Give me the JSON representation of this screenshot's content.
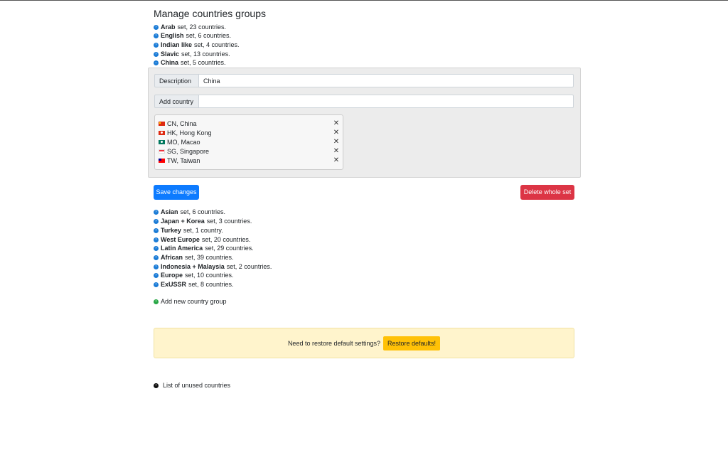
{
  "page_title": "Manage countries groups",
  "groups_top": [
    {
      "name": "Arab",
      "desc": "set, 23 countries."
    },
    {
      "name": "English",
      "desc": "set, 6 countries."
    },
    {
      "name": "Indian like",
      "desc": "set, 4 countries."
    },
    {
      "name": "Slavic",
      "desc": "set, 13 countries."
    },
    {
      "name": "China",
      "desc": "set, 5 countries."
    }
  ],
  "editor": {
    "description_label": "Description",
    "description_value": "China",
    "add_country_label": "Add country",
    "add_country_value": "",
    "countries": [
      {
        "label": "CN, China",
        "flag": "flag-cn"
      },
      {
        "label": "HK, Hong Kong",
        "flag": "flag-hk"
      },
      {
        "label": "MO, Macao",
        "flag": "flag-mo"
      },
      {
        "label": "SG, Singapore",
        "flag": "flag-sg"
      },
      {
        "label": "TW, Taiwan",
        "flag": "flag-tw"
      }
    ],
    "remove_symbol": "✕",
    "save_label": "Save changes",
    "delete_label": "Delete whole set"
  },
  "groups_bottom": [
    {
      "name": "Asian",
      "desc": "set, 6 countries."
    },
    {
      "name": "Japan + Korea",
      "desc": "set, 3 countries."
    },
    {
      "name": "Turkey",
      "desc": "set, 1 country."
    },
    {
      "name": "West Europe",
      "desc": "set, 20 countries."
    },
    {
      "name": "Latin America",
      "desc": "set, 29 countries."
    },
    {
      "name": "African",
      "desc": "set, 39 countries."
    },
    {
      "name": "Indonesia + Malaysia",
      "desc": "set, 2 countries."
    },
    {
      "name": "Europe",
      "desc": "set, 10 countries."
    },
    {
      "name": "ExUSSR",
      "desc": "set, 8 countries."
    }
  ],
  "add_group_label": "Add new country group",
  "restore": {
    "text": "Need to restore default settings?",
    "button_label": "Restore defaults!"
  },
  "unused_label": "List of unused countries",
  "colors": {
    "primary": "#0d7bff",
    "danger": "#dc3545",
    "warning": "#ffc107",
    "alert_bg": "#fff4cc",
    "chevron": "#1a7bd6",
    "add_icon": "#28a745"
  }
}
